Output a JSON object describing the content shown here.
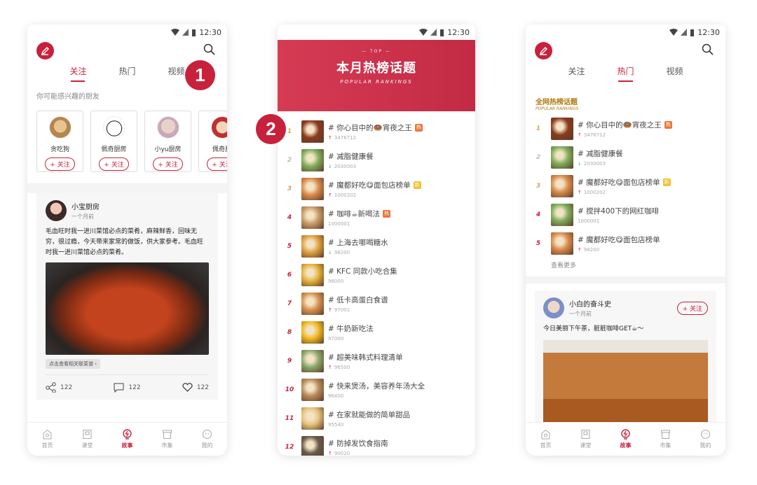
{
  "status": {
    "time": "12:30"
  },
  "callouts": [
    "1",
    "2"
  ],
  "phone1": {
    "tabs": [
      "关注",
      "热门",
      "视频"
    ],
    "suggest_label": "你可能感兴趣的厨友",
    "users": [
      {
        "name": "贪吃狗",
        "follow": "+ 关注"
      },
      {
        "name": "佩奇厨房",
        "follow": "+ 关注"
      },
      {
        "name": "小yu厨房",
        "follow": "+ 关注"
      },
      {
        "name": "佩奇厨",
        "follow": "+ 关注"
      }
    ],
    "post": {
      "author": "小宝厨房",
      "time": "一个月前",
      "text": "毛血旺时我一进川菜馆必点的菜肴，麻辣鲜香，回味无穷，很过瘾，今天带来家常的做饭，供大家参考。毛血旺时我一进川菜馆必点的菜肴。",
      "tag": "点击查看相关联菜谱 ›",
      "share": "122",
      "comment": "122",
      "like": "122"
    }
  },
  "bottom_nav": [
    "首页",
    "课堂",
    "故事",
    "市集",
    "我的"
  ],
  "phone2": {
    "banner_top": "— TOP —",
    "banner_title": "本月热榜话题",
    "banner_sub": "POPULAR RANKINGS",
    "ranks": [
      {
        "num": "1",
        "title": "# 你心目中的🍩宵夜之王",
        "count": "3476712",
        "trend": "up",
        "badge": "热",
        "badge_type": "hot",
        "thumb": "#8a3a1c"
      },
      {
        "num": "2",
        "title": "# 减脂健康餐",
        "count": "2030003",
        "trend": "down",
        "badge": "",
        "badge_type": "",
        "thumb": "#7fae5a"
      },
      {
        "num": "3",
        "title": "# 魔都好吃😋面包店榜单",
        "count": "1000202",
        "trend": "up",
        "badge": "新",
        "badge_type": "new",
        "thumb": "#d98a4a"
      },
      {
        "num": "4",
        "title": "# 咖啡☕新喝法",
        "count": "1000001",
        "trend": "none",
        "badge": "热",
        "badge_type": "hot",
        "thumb": "#c99a63"
      },
      {
        "num": "5",
        "title": "# 上海去哪喝糖水",
        "count": "98200",
        "trend": "down",
        "badge": "",
        "badge_type": "",
        "thumb": "#e0a040"
      },
      {
        "num": "6",
        "title": "# KFC 同款小吃合集",
        "count": "98000",
        "trend": "none",
        "badge": "",
        "badge_type": "",
        "thumb": "#e6b23a"
      },
      {
        "num": "7",
        "title": "# 低卡高蛋白食谱",
        "count": "97001",
        "trend": "up",
        "badge": "",
        "badge_type": "",
        "thumb": "#d8924e"
      },
      {
        "num": "8",
        "title": "# 牛奶新吃法",
        "count": "97000",
        "trend": "none",
        "badge": "",
        "badge_type": "",
        "thumb": "#f2b822"
      },
      {
        "num": "9",
        "title": "# 超美味韩式料理清单",
        "count": "96500",
        "trend": "up",
        "badge": "",
        "badge_type": "",
        "thumb": "#8aa86a"
      },
      {
        "num": "10",
        "title": "# 快来煲汤，美容养年汤大全",
        "count": "96400",
        "trend": "none",
        "badge": "",
        "badge_type": "",
        "thumb": "#b88a5a"
      },
      {
        "num": "11",
        "title": "# 在家就能做的简单甜品",
        "count": "95540",
        "trend": "none",
        "badge": "",
        "badge_type": "",
        "thumb": "#e7c27a"
      },
      {
        "num": "12",
        "title": "# 防掉发饮食指南",
        "count": "90020",
        "trend": "up",
        "badge": "",
        "badge_type": "",
        "thumb": "#6a5a4a"
      }
    ]
  },
  "phone3": {
    "tabs": [
      "关注",
      "热门",
      "视频"
    ],
    "hot_title": "全网热榜话题",
    "hot_sub": "POPULAR RANKINGS",
    "ranks": [
      {
        "num": "1",
        "title": "# 你心目中的🍩宵夜之王",
        "count": "3476712",
        "trend": "up",
        "badge": "热",
        "badge_type": "hot",
        "thumb": "#8a3a1c"
      },
      {
        "num": "2",
        "title": "# 减脂健康餐",
        "count": "2030003",
        "trend": "down",
        "badge": "",
        "badge_type": "",
        "thumb": "#7fae5a"
      },
      {
        "num": "3",
        "title": "# 魔都好吃😋面包店榜单",
        "count": "1000202",
        "trend": "up",
        "badge": "新",
        "badge_type": "new",
        "thumb": "#d98a4a"
      },
      {
        "num": "4",
        "title": "# 搅拌400下的网红咖啡",
        "count": "1000001",
        "trend": "none",
        "badge": "",
        "badge_type": "",
        "thumb": "#7fae5a"
      },
      {
        "num": "5",
        "title": "# 魔都好吃😋面包店榜单",
        "count": "98200",
        "trend": "up",
        "badge": "",
        "badge_type": "",
        "thumb": "#d98a4a"
      }
    ],
    "more": "查看更多",
    "post": {
      "author": "小白的奋斗史",
      "time": "一个月前",
      "follow": "+ 关注",
      "text": "今日美丽下午茶，脏脏咖啡GET☕～"
    }
  }
}
